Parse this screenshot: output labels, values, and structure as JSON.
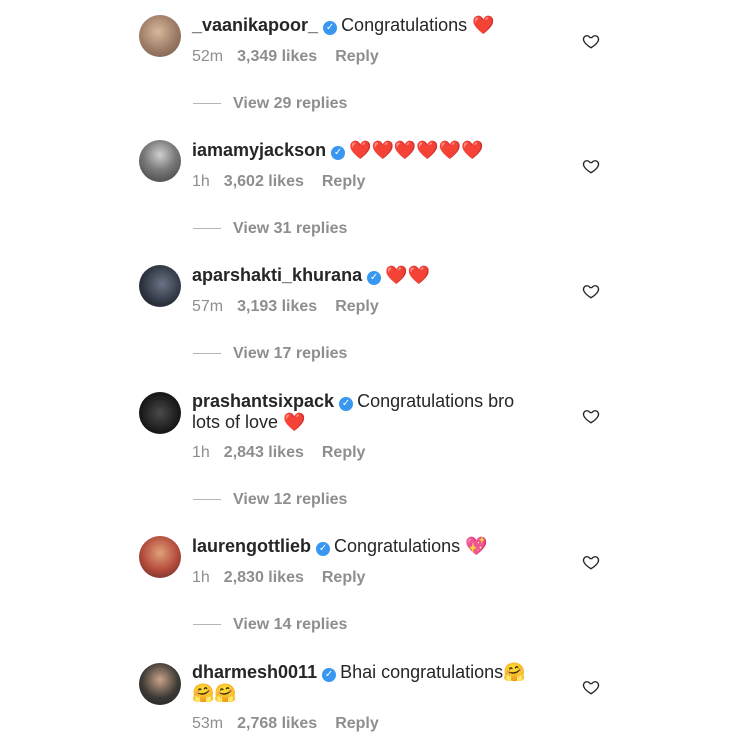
{
  "comments": [
    {
      "username": "_vaanikapoor_",
      "verified": true,
      "text": "Congratulations ❤️",
      "time": "52m",
      "likes": "3,349 likes",
      "reply": "Reply",
      "view_replies": "View 29 replies",
      "avatar_color": "#9b7b65"
    },
    {
      "username": "iamamyjackson",
      "verified": true,
      "text": "❤️❤️❤️❤️❤️❤️",
      "time": "1h",
      "likes": "3,602 likes",
      "reply": "Reply",
      "view_replies": "View 31 replies",
      "avatar_color": "#5a5a5a"
    },
    {
      "username": "aparshakti_khurana",
      "verified": true,
      "text": "❤️❤️",
      "time": "57m",
      "likes": "3,193 likes",
      "reply": "Reply",
      "view_replies": "View 17 replies",
      "avatar_color": "#2e3440"
    },
    {
      "username": "prashantsixpack",
      "verified": true,
      "text": "Congratulations bro lots of love ❤️",
      "time": "1h",
      "likes": "2,843 likes",
      "reply": "Reply",
      "view_replies": "View 12 replies",
      "avatar_color": "#1c1c1c"
    },
    {
      "username": "laurengottlieb",
      "verified": true,
      "text": "Congratulations 💖",
      "time": "1h",
      "likes": "2,830 likes",
      "reply": "Reply",
      "view_replies": "View 14 replies",
      "avatar_color": "#b24a3b"
    },
    {
      "username": "dharmesh0011",
      "verified": true,
      "text": "Bhai congratulations🤗 🤗🤗",
      "time": "53m",
      "likes": "2,768 likes",
      "reply": "Reply",
      "avatar_color": "#3d3a36"
    }
  ],
  "colors": {
    "text": "#262626",
    "meta": "#8e8e8e",
    "verified_badge": "#3897f0",
    "heart_emoji": "#e0245e"
  },
  "icons": {
    "like": "heart-outline-icon",
    "verified": "verified-badge-icon"
  }
}
